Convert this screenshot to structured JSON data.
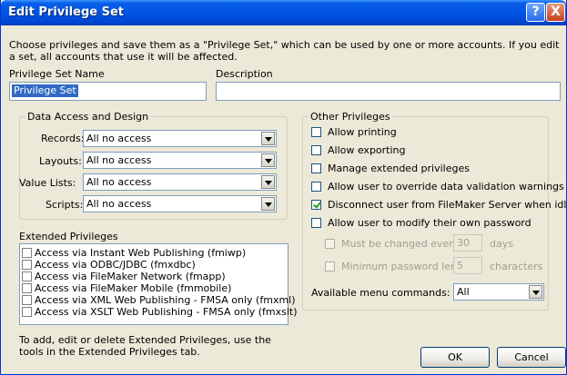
{
  "window": {
    "title": "Edit Privilege Set",
    "help_glyph": "?",
    "close_glyph": "X"
  },
  "intro": "Choose privileges and save them as a \"Privilege Set,\" which can be used by one or more accounts. If you edit a set, all accounts that use it will be affected.",
  "name_field": {
    "label": "Privilege Set Name",
    "value": "Privilege Set"
  },
  "description_field": {
    "label": "Description",
    "value": ""
  },
  "data_access": {
    "title": "Data Access and Design",
    "records": {
      "label": "Records:",
      "value": "All no access"
    },
    "layouts": {
      "label": "Layouts:",
      "value": "All no access"
    },
    "value_lists": {
      "label": "Value Lists:",
      "value": "All no access"
    },
    "scripts": {
      "label": "Scripts:",
      "value": "All no access"
    }
  },
  "extended": {
    "title": "Extended Privileges",
    "items": [
      {
        "label": "Access via Instant Web Publishing (fmiwp)",
        "checked": false
      },
      {
        "label": "Access via ODBC/JDBC (fmxdbc)",
        "checked": false
      },
      {
        "label": "Access via FileMaker Network (fmapp)",
        "checked": false
      },
      {
        "label": "Access via FileMaker Mobile (fmmobile)",
        "checked": false
      },
      {
        "label": "Access via XML Web Publishing - FMSA only (fmxml)",
        "checked": false
      },
      {
        "label": "Access via XSLT Web Publishing - FMSA only (fmxslt)",
        "checked": false
      }
    ],
    "note": "To add, edit or delete Extended Privileges, use the tools in the Extended Privileges tab."
  },
  "other": {
    "title": "Other Privileges",
    "allow_printing": {
      "label": "Allow printing",
      "checked": false
    },
    "allow_exporting": {
      "label": "Allow exporting",
      "checked": false
    },
    "manage_extended": {
      "label": "Manage extended privileges",
      "checked": false
    },
    "override_validation": {
      "label": "Allow user to override data validation warnings",
      "checked": false
    },
    "disconnect_idle": {
      "label": "Disconnect user from FileMaker Server when idle",
      "checked": true
    },
    "modify_password": {
      "label": "Allow user to modify their own password",
      "checked": false
    },
    "must_change": {
      "label": "Must be changed every",
      "value": "30",
      "unit": "days",
      "enabled": false
    },
    "min_length": {
      "label": "Minimum password length:",
      "value": "5",
      "unit": "characters",
      "enabled": false
    },
    "menu_commands": {
      "label": "Available menu commands:",
      "value": "All"
    }
  },
  "buttons": {
    "ok": "OK",
    "cancel": "Cancel"
  }
}
